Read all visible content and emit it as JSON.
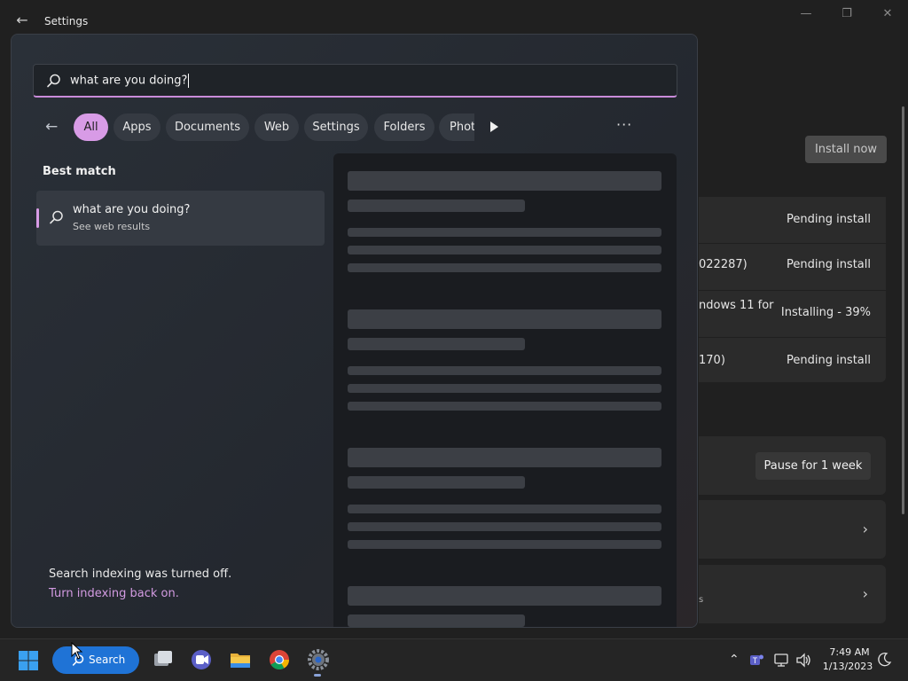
{
  "window": {
    "title": "Settings",
    "minimize_glyph": "—",
    "maximize_glyph": "❐",
    "close_glyph": "✕"
  },
  "settings": {
    "install_now": "Install now",
    "updates": [
      {
        "name": "",
        "status": "Pending install"
      },
      {
        "name": "022287)",
        "status": "Pending install"
      },
      {
        "name": "ndows 11 for",
        "status": "Installing - 39%"
      },
      {
        "name": "170)",
        "status": "Pending install"
      }
    ],
    "pause_label": "Pause for 1 week",
    "nav_partial_text": "s"
  },
  "search": {
    "query": "what are you doing?",
    "filters": [
      "All",
      "Apps",
      "Documents",
      "Web",
      "Settings",
      "Folders",
      "Phot"
    ],
    "active_filter": "All",
    "best_match_heading": "Best match",
    "result": {
      "title": "what are you doing?",
      "subtitle": "See web results"
    },
    "indexing_message": "Search indexing was turned off.",
    "indexing_link": "Turn indexing back on."
  },
  "taskbar": {
    "search_label": "Search",
    "time": "7:49 AM",
    "date": "1/13/2023",
    "icons": [
      "windows-start-icon",
      "search-icon",
      "task-view-icon",
      "teams-chat-icon",
      "file-explorer-icon",
      "chrome-icon",
      "settings-gear-icon"
    ],
    "tray": [
      "chevron-up-icon",
      "teams-icon",
      "network-icon",
      "volume-icon",
      "focus-moon-icon"
    ]
  },
  "colors": {
    "accent_pink": "#d89be6",
    "taskbar_search_blue": "#1f73d6",
    "link": "#d39be2"
  }
}
